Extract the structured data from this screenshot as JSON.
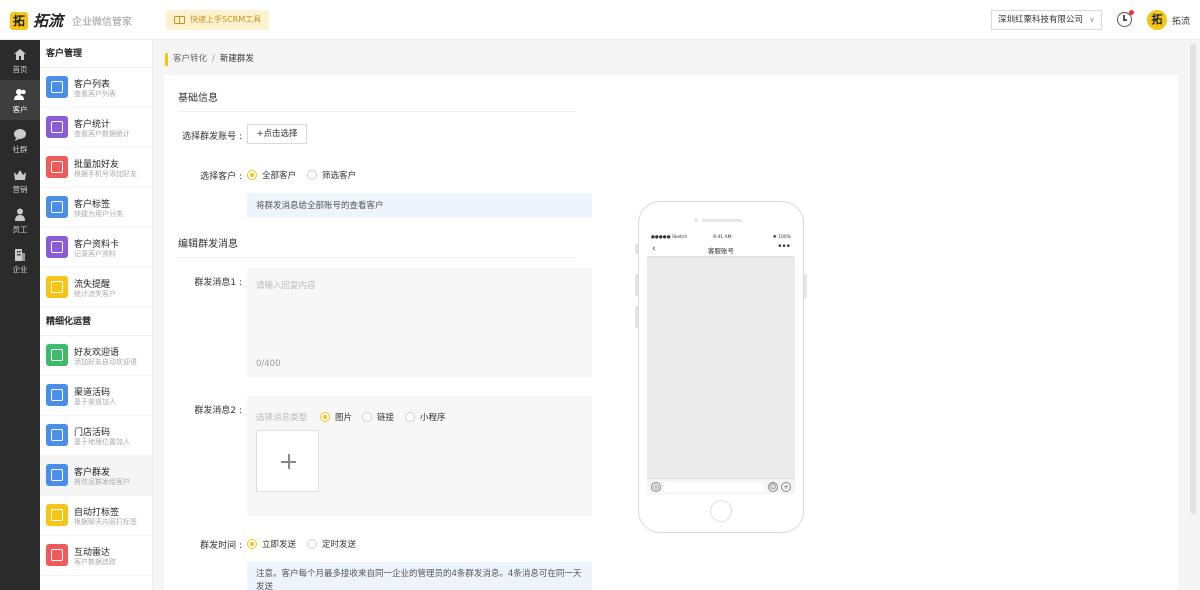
{
  "header": {
    "logo_glyph": "拓",
    "logo_text": "拓流",
    "subtitle": "企业微信管家",
    "quick_button": "快速上手SCRM工具",
    "company": "深圳红栗科技有限公司",
    "user_name": "拓流",
    "avatar_glyph": "拓"
  },
  "rail": [
    {
      "label": "首页",
      "icon": "home-icon"
    },
    {
      "label": "客户",
      "icon": "user-group-icon",
      "active": true
    },
    {
      "label": "社群",
      "icon": "chat-icon"
    },
    {
      "label": "营销",
      "icon": "crown-icon"
    },
    {
      "label": "员工",
      "icon": "person-icon"
    },
    {
      "label": "企业",
      "icon": "building-icon"
    }
  ],
  "nav2": {
    "section1": "客户管理",
    "section2": "精细化运营",
    "items1": [
      {
        "title": "客户列表",
        "sub": "查看客户列表",
        "color": "#4a8ee8"
      },
      {
        "title": "客户统计",
        "sub": "查看客户数据统计",
        "color": "#8a5cd6"
      },
      {
        "title": "批量加好友",
        "sub": "根据手机号添加好友",
        "color": "#ef5a5a"
      },
      {
        "title": "客户标签",
        "sub": "快捷为用户分类",
        "color": "#4a8ee8"
      },
      {
        "title": "客户资料卡",
        "sub": "记录客户资料",
        "color": "#8a5cd6"
      },
      {
        "title": "流失提醒",
        "sub": "统计流失客户",
        "color": "#f5c518"
      }
    ],
    "items2": [
      {
        "title": "好友欢迎语",
        "sub": "添加好友自动欢迎语",
        "color": "#3dba6a"
      },
      {
        "title": "渠道活码",
        "sub": "基于渠道加人",
        "color": "#4a8ee8"
      },
      {
        "title": "门店活码",
        "sub": "基于地理位置加人",
        "color": "#4a8ee8"
      },
      {
        "title": "客户群发",
        "sub": "将信息群发给客户",
        "color": "#4a8ee8",
        "active": true
      },
      {
        "title": "自动打标签",
        "sub": "根据聊天内容打标签",
        "color": "#f5c518"
      },
      {
        "title": "互动雷达",
        "sub": "客户数据追踪",
        "color": "#ef5a5a"
      }
    ]
  },
  "breadcrumb": {
    "parent": "客户转化",
    "separator": "/",
    "current": "新建群发"
  },
  "form": {
    "section_basic": "基础信息",
    "label_account": "选择群发账号 :",
    "account_button": "+点击选择",
    "label_customer": "选择客户 :",
    "customer_all": "全部客户",
    "customer_filter": "筛选客户",
    "customer_info": "将群发消息给全部账号的查看客户",
    "section_edit": "编辑群发消息",
    "label_msg1": "群发消息1 :",
    "msg1_placeholder": "请输入回复内容",
    "msg1_count": "0/400",
    "label_msg2": "群发消息2 :",
    "msg2_type_label": "选择消息类型",
    "msg2_image": "图片",
    "msg2_link": "链接",
    "msg2_miniprogram": "小程序",
    "label_time": "群发时间 :",
    "time_now": "立即发送",
    "time_scheduled": "定时发送",
    "time_info": "注意。客户每个月最多接收来自同一企业的管理员的4条群发消息。4条消息可在同一天发送"
  },
  "phone": {
    "carrier": "●●●●● Sketch",
    "time": "9:41 AM",
    "battery": "✱ 100%",
    "back": "‹",
    "title": "客服账号",
    "more": "•••",
    "voice": "◎",
    "emoji": "☺",
    "plus": "+"
  }
}
